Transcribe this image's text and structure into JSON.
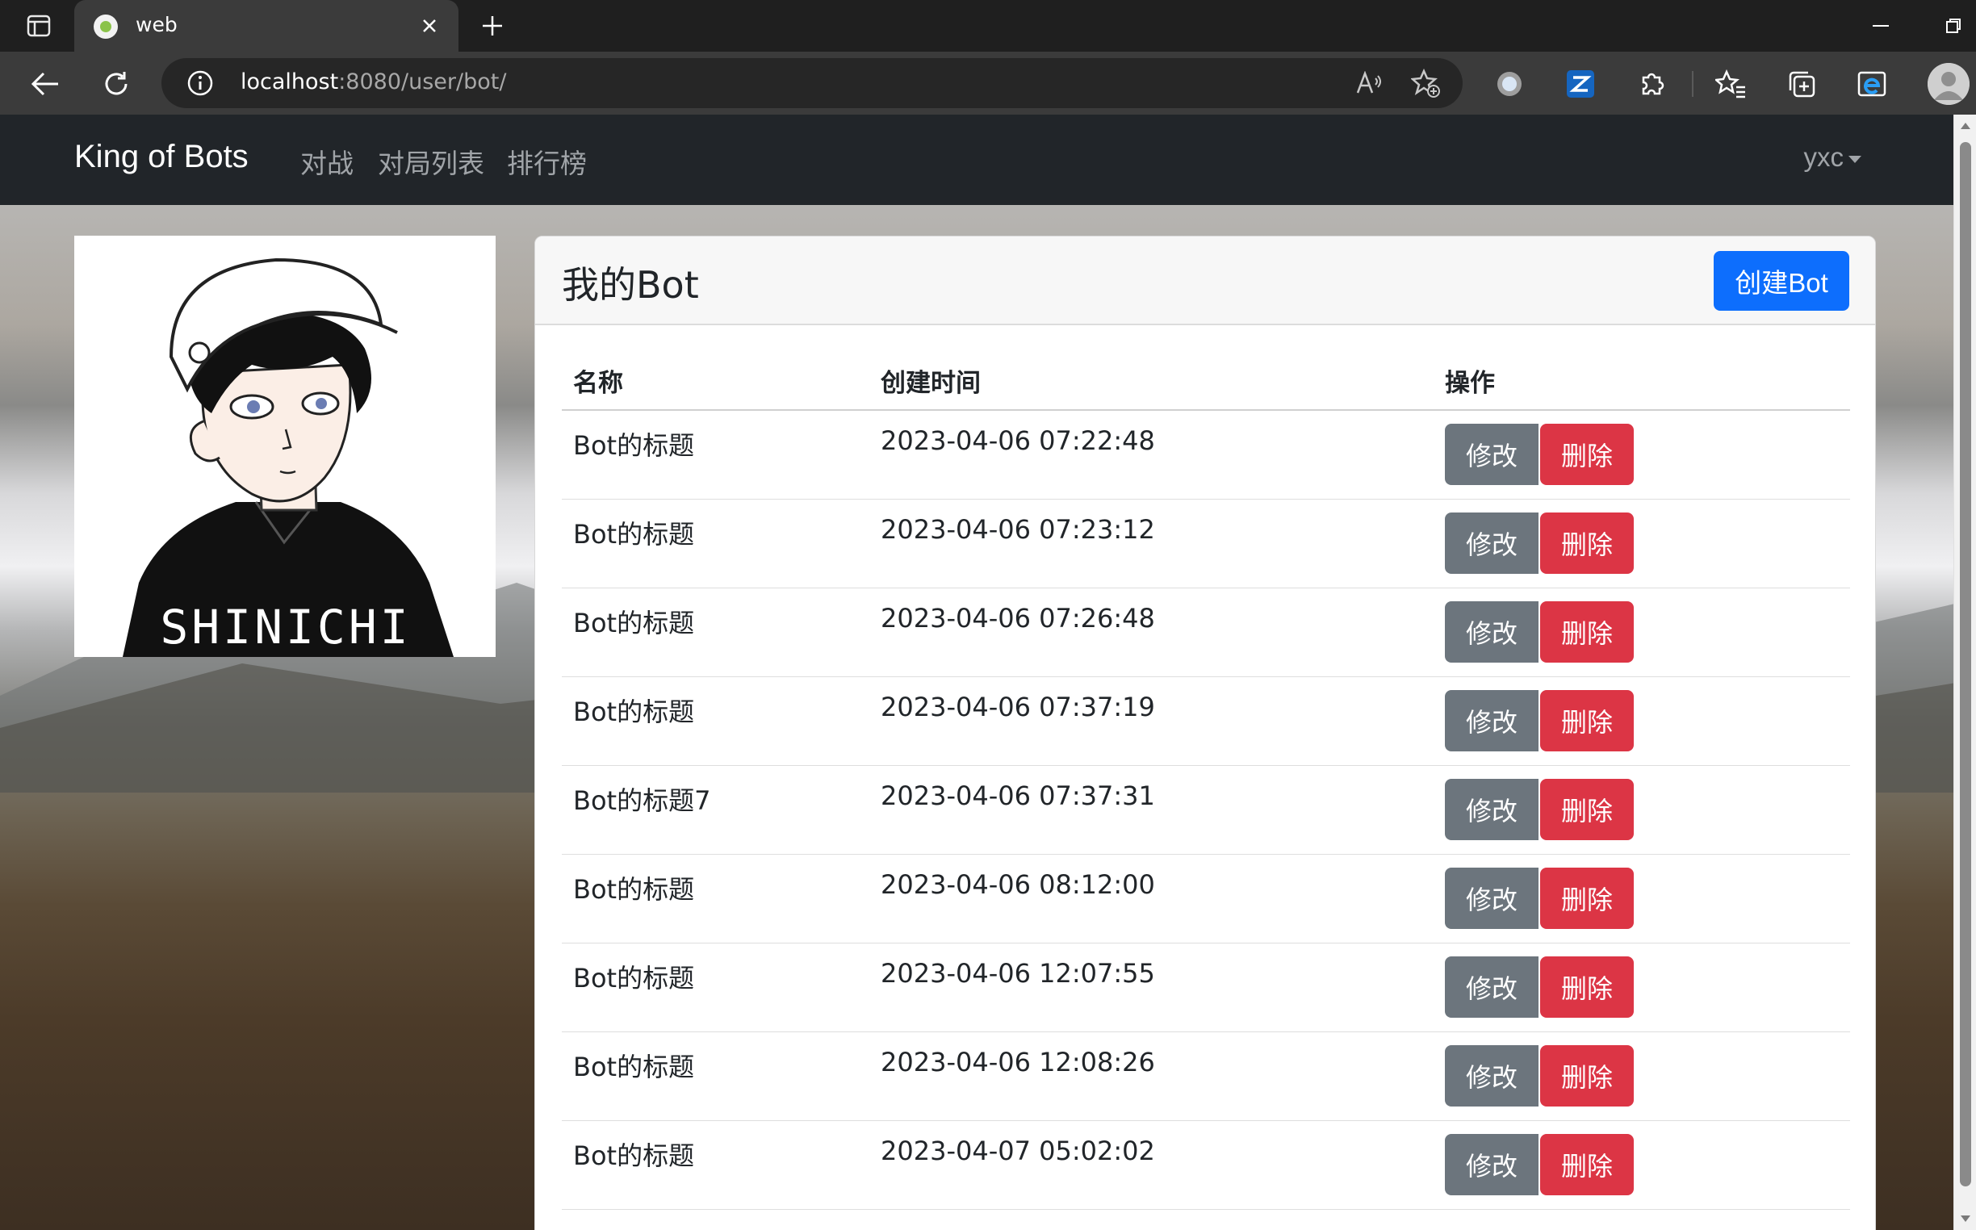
{
  "browser": {
    "tab_title": "web",
    "url_host": "localhost",
    "url_rest": ":8080/user/bot/"
  },
  "navbar": {
    "brand": "King of Bots",
    "links": [
      "对战",
      "对局列表",
      "排行榜"
    ],
    "username": "yxc"
  },
  "profile": {
    "shirt_text": "SHINICHI"
  },
  "bots": {
    "title": "我的Bot",
    "create_label": "创建Bot",
    "columns": [
      "名称",
      "创建时间",
      "操作"
    ],
    "edit_label": "修改",
    "delete_label": "删除",
    "rows": [
      {
        "name": "Bot的标题",
        "created": "2023-04-06 07:22:48"
      },
      {
        "name": "Bot的标题",
        "created": "2023-04-06 07:23:12"
      },
      {
        "name": "Bot的标题",
        "created": "2023-04-06 07:26:48"
      },
      {
        "name": "Bot的标题",
        "created": "2023-04-06 07:37:19"
      },
      {
        "name": "Bot的标题7",
        "created": "2023-04-06 07:37:31"
      },
      {
        "name": "Bot的标题",
        "created": "2023-04-06 08:12:00"
      },
      {
        "name": "Bot的标题",
        "created": "2023-04-06 12:07:55"
      },
      {
        "name": "Bot的标题",
        "created": "2023-04-06 12:08:26"
      },
      {
        "name": "Bot的标题",
        "created": "2023-04-07 05:02:02"
      }
    ]
  },
  "colors": {
    "primary": "#0d6efd",
    "secondary": "#6c757d",
    "danger": "#dc3545",
    "navbar": "#212529"
  },
  "icons": [
    "tab-actions-icon",
    "close-icon",
    "plus-icon",
    "back-icon",
    "reload-icon",
    "info-icon",
    "read-aloud-icon",
    "add-favorite-icon",
    "extension-circle-icon",
    "zotero-icon",
    "puzzle-icon",
    "favorites-icon",
    "collections-icon",
    "ie-mode-icon",
    "profile-icon"
  ]
}
